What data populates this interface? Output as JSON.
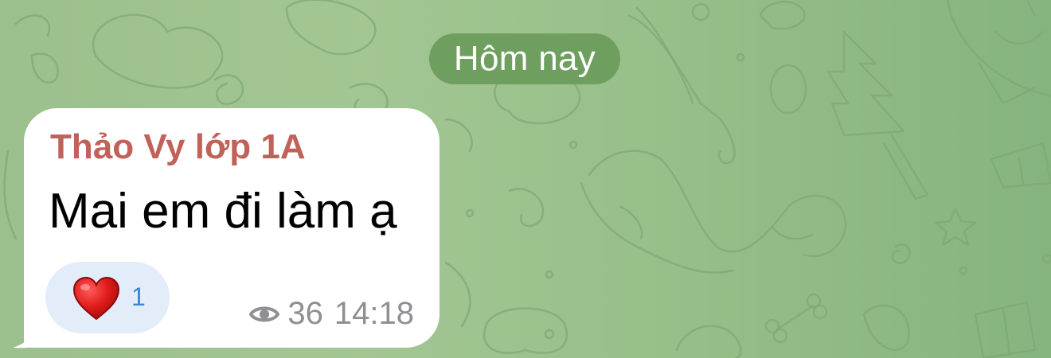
{
  "chat": {
    "date_separator": "Hôm nay"
  },
  "message": {
    "sender": "Thảo Vy lớp 1A",
    "text": "Mai em đi làm ạ",
    "reaction": {
      "emoji_icon": "heart-icon",
      "count": "1"
    },
    "views": "36",
    "time": "14:18"
  },
  "colors": {
    "sender_name": "#c0615a",
    "date_pill": "#6f9f5f",
    "reaction_bg": "#e3edf9",
    "reaction_count": "#3a86d1",
    "meta_text": "#8f8f94"
  }
}
